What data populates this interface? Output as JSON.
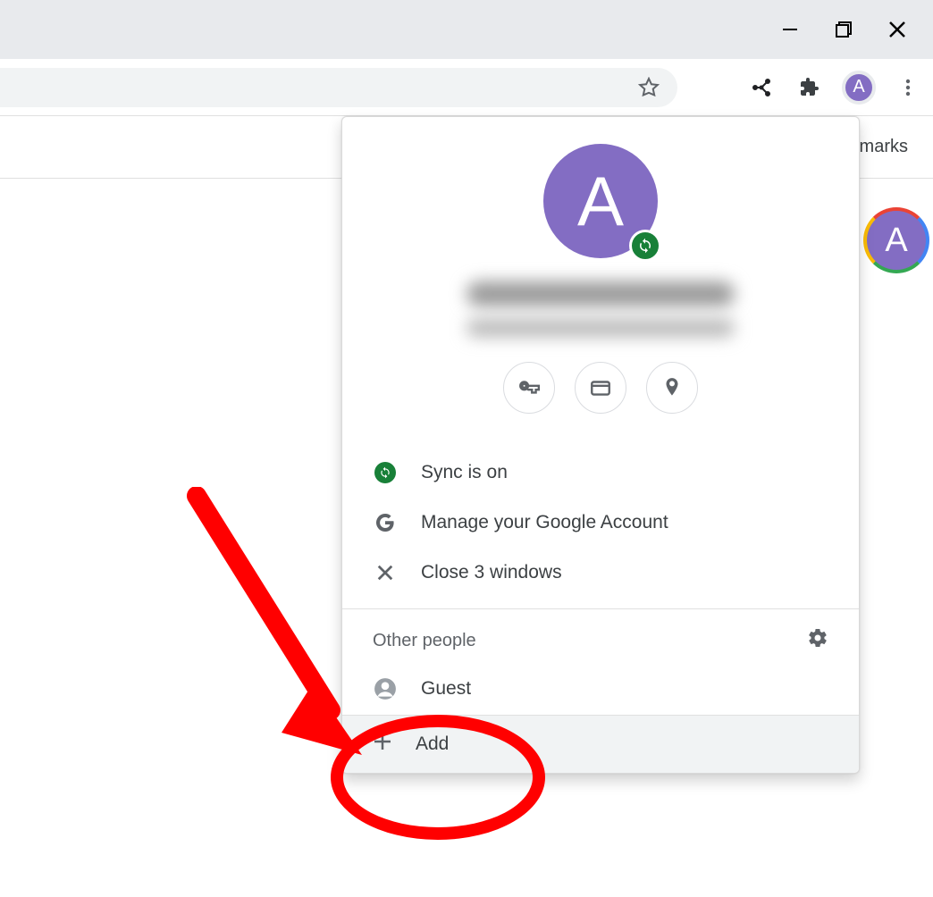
{
  "titlebar": {},
  "toolbar": {
    "avatar_letter": "A"
  },
  "bookmarks": {
    "partial_text": "marks"
  },
  "background_avatar": {
    "letter": "A"
  },
  "popup": {
    "avatar_letter": "A",
    "sync": {
      "label": "Sync is on"
    },
    "manage_label": "Manage your Google Account",
    "close_label": "Close 3 windows",
    "other_people_header": "Other people",
    "guest_label": "Guest",
    "add_label": "Add"
  }
}
